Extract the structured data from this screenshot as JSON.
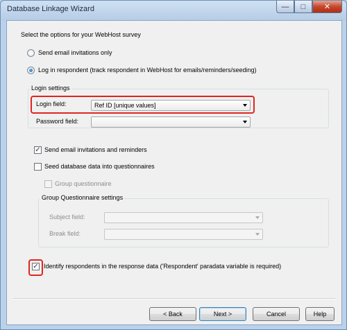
{
  "window": {
    "title": "Database Linkage Wizard"
  },
  "intro": "Select the options for your WebHost survey",
  "options": {
    "email_only": {
      "label": "Send email invitations only",
      "selected": false
    },
    "login": {
      "label": "Log in respondent  (track respondent in WebHost for emails/reminders/seeding)",
      "selected": true
    }
  },
  "login_settings": {
    "title": "Login settings",
    "login_field": {
      "label": "Login field:",
      "value": "Ref ID [unique values]"
    },
    "password_field": {
      "label": "Password field:",
      "value": ""
    }
  },
  "checks": {
    "send_email": {
      "label": "Send email invitations and reminders",
      "checked": true
    },
    "seed": {
      "label": "Seed database data into questionnaires",
      "checked": false
    },
    "group_q": {
      "label": "Group questionnaire",
      "checked": false
    }
  },
  "group_settings": {
    "title": "Group Questionnaire settings",
    "subject_field": {
      "label": "Subject field:",
      "value": ""
    },
    "break_field": {
      "label": "Break field:",
      "value": ""
    }
  },
  "identify": {
    "label": "Identify respondents in the response data ('Respondent' paradata variable is required)",
    "checked": true
  },
  "buttons": {
    "back": "< Back",
    "next": "Next >",
    "cancel": "Cancel",
    "help": "Help"
  },
  "colors": {
    "highlight": "#e0241f",
    "dialog_bg": "#f0f0f0",
    "frame": "#b9d1ea"
  }
}
